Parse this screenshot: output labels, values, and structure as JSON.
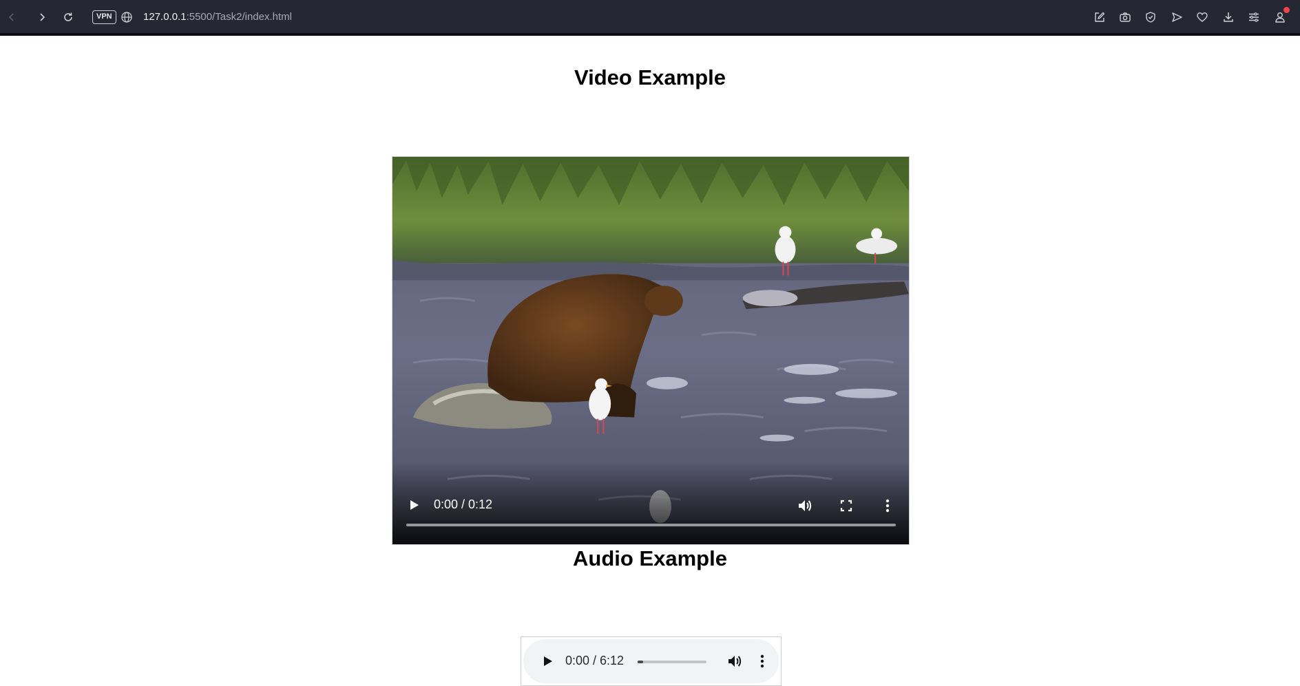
{
  "browser": {
    "vpn_label": "VPN",
    "url_host": "127.0.0.1",
    "url_rest": ":5500/Task2/index.html",
    "toolbar_icons": [
      "edit-icon",
      "camera-icon",
      "shield-icon",
      "send-icon",
      "heart-icon",
      "download-icon",
      "menu-icon",
      "profile-icon"
    ],
    "notification_color": "#f0444f"
  },
  "page": {
    "video_heading": "Video Example",
    "audio_heading": "Audio Example"
  },
  "video": {
    "time": "0:00 / 0:12",
    "progress": 0
  },
  "audio": {
    "time": "0:00 / 6:12",
    "progress": 0.08
  }
}
